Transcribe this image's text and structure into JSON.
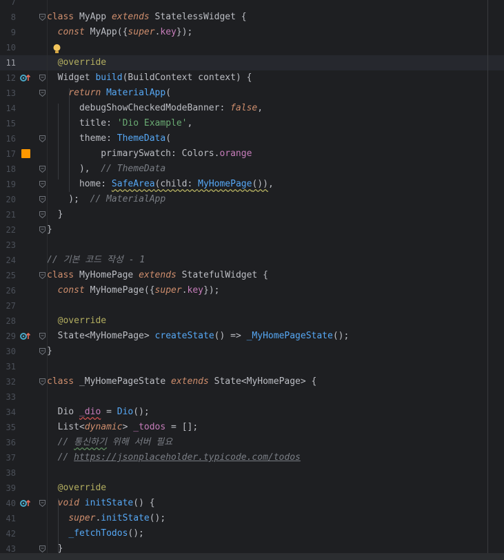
{
  "editor": {
    "language": "Dart",
    "current_line": "11",
    "lines": [
      {
        "n": "7",
        "tokens": []
      },
      {
        "n": "8",
        "tokens": [
          [
            "kw",
            "class"
          ],
          [
            "cls",
            " MyApp "
          ],
          [
            "kwi",
            "extends"
          ],
          [
            "cls",
            " StatelessWidget {"
          ]
        ]
      },
      {
        "n": "9",
        "tokens": [
          [
            "cls",
            "  "
          ],
          [
            "kwi",
            "const"
          ],
          [
            "cls",
            " MyApp({"
          ],
          [
            "kwi",
            "super"
          ],
          [
            "cls",
            "."
          ],
          [
            "prop",
            "key"
          ],
          [
            "cls",
            "});"
          ]
        ]
      },
      {
        "n": "10",
        "tokens": []
      },
      {
        "n": "11",
        "tokens": [
          [
            "cls",
            "  "
          ],
          [
            "anno",
            "@override"
          ]
        ]
      },
      {
        "n": "12",
        "tokens": [
          [
            "cls",
            "  Widget "
          ],
          [
            "fn",
            "build"
          ],
          [
            "cls",
            "(BuildContext context) {"
          ]
        ]
      },
      {
        "n": "13",
        "tokens": [
          [
            "cls",
            "    "
          ],
          [
            "kwi",
            "return"
          ],
          [
            "cls",
            " "
          ],
          [
            "fn",
            "MaterialApp"
          ],
          [
            "cls",
            "("
          ]
        ]
      },
      {
        "n": "14",
        "tokens": [
          [
            "cls",
            "      debugShowCheckedModeBanner: "
          ],
          [
            "kwi",
            "false"
          ],
          [
            "cls",
            ","
          ]
        ]
      },
      {
        "n": "15",
        "tokens": [
          [
            "cls",
            "      title: "
          ],
          [
            "str",
            "'Dio Example'"
          ],
          [
            "cls",
            ","
          ]
        ]
      },
      {
        "n": "16",
        "tokens": [
          [
            "cls",
            "      theme: "
          ],
          [
            "fn",
            "ThemeData"
          ],
          [
            "cls",
            "("
          ]
        ]
      },
      {
        "n": "17",
        "tokens": [
          [
            "cls",
            "          primarySwatch: Colors."
          ],
          [
            "prop",
            "orange"
          ]
        ]
      },
      {
        "n": "18",
        "tokens": [
          [
            "cls",
            "      ),  "
          ],
          [
            "cmt",
            "// ThemeData"
          ]
        ]
      },
      {
        "n": "19",
        "tokens": [
          [
            "cls",
            "      home: "
          ],
          [
            "fn warn-u",
            "SafeArea"
          ],
          [
            "cls warn-u",
            "(child: "
          ],
          [
            "fn warn-u",
            "MyHomePage"
          ],
          [
            "cls warn-u",
            "())"
          ],
          [
            "cls",
            ","
          ]
        ]
      },
      {
        "n": "20",
        "tokens": [
          [
            "cls",
            "    );  "
          ],
          [
            "cmt",
            "// MaterialApp"
          ]
        ]
      },
      {
        "n": "21",
        "tokens": [
          [
            "cls",
            "  }"
          ]
        ]
      },
      {
        "n": "22",
        "tokens": [
          [
            "cls",
            "}"
          ]
        ]
      },
      {
        "n": "23",
        "tokens": []
      },
      {
        "n": "24",
        "tokens": [
          [
            "cmt",
            "// 기본 코드 작성 - 1"
          ]
        ]
      },
      {
        "n": "25",
        "tokens": [
          [
            "kw",
            "class"
          ],
          [
            "cls",
            " MyHomePage "
          ],
          [
            "kwi",
            "extends"
          ],
          [
            "cls",
            " StatefulWidget {"
          ]
        ]
      },
      {
        "n": "26",
        "tokens": [
          [
            "cls",
            "  "
          ],
          [
            "kwi",
            "const"
          ],
          [
            "cls",
            " MyHomePage({"
          ],
          [
            "kwi",
            "super"
          ],
          [
            "cls",
            "."
          ],
          [
            "prop",
            "key"
          ],
          [
            "cls",
            "});"
          ]
        ]
      },
      {
        "n": "27",
        "tokens": []
      },
      {
        "n": "28",
        "tokens": [
          [
            "cls",
            "  "
          ],
          [
            "anno",
            "@override"
          ]
        ]
      },
      {
        "n": "29",
        "tokens": [
          [
            "cls",
            "  State<MyHomePage> "
          ],
          [
            "fn",
            "createState"
          ],
          [
            "cls",
            "() => "
          ],
          [
            "fn",
            "_MyHomePageState"
          ],
          [
            "cls",
            "();"
          ]
        ]
      },
      {
        "n": "30",
        "tokens": [
          [
            "cls",
            "}"
          ]
        ]
      },
      {
        "n": "31",
        "tokens": []
      },
      {
        "n": "32",
        "tokens": [
          [
            "kw",
            "class"
          ],
          [
            "cls",
            " _MyHomePageState "
          ],
          [
            "kwi",
            "extends"
          ],
          [
            "cls",
            " State<MyHomePage> {"
          ]
        ]
      },
      {
        "n": "33",
        "tokens": []
      },
      {
        "n": "34",
        "tokens": [
          [
            "cls",
            "  Dio "
          ],
          [
            "prop err-u",
            "_dio"
          ],
          [
            "cls",
            " = "
          ],
          [
            "fn",
            "Dio"
          ],
          [
            "cls",
            "();"
          ]
        ]
      },
      {
        "n": "35",
        "tokens": [
          [
            "cls",
            "  List<"
          ],
          [
            "kwi",
            "dynamic"
          ],
          [
            "cls",
            "> "
          ],
          [
            "prop",
            "_todos"
          ],
          [
            "cls",
            " = [];"
          ]
        ]
      },
      {
        "n": "36",
        "tokens": [
          [
            "cmt",
            "  // "
          ],
          [
            "cmt typo-u",
            "통신하기"
          ],
          [
            "cmt",
            " 위해 서버 필요"
          ]
        ]
      },
      {
        "n": "37",
        "tokens": [
          [
            "cmt",
            "  // "
          ],
          [
            "link",
            "https://jsonplaceholder.typicode.com/todos"
          ]
        ]
      },
      {
        "n": "38",
        "tokens": []
      },
      {
        "n": "39",
        "tokens": [
          [
            "cls",
            "  "
          ],
          [
            "anno",
            "@override"
          ]
        ]
      },
      {
        "n": "40",
        "tokens": [
          [
            "cls",
            "  "
          ],
          [
            "kwi",
            "void"
          ],
          [
            "cls",
            " "
          ],
          [
            "fn",
            "initState"
          ],
          [
            "cls",
            "() {"
          ]
        ]
      },
      {
        "n": "41",
        "tokens": [
          [
            "cls",
            "    "
          ],
          [
            "kwi",
            "super"
          ],
          [
            "cls",
            "."
          ],
          [
            "fn",
            "initState"
          ],
          [
            "cls",
            "();"
          ]
        ]
      },
      {
        "n": "42",
        "tokens": [
          [
            "cls",
            "    "
          ],
          [
            "fn",
            "_fetchTodos"
          ],
          [
            "cls",
            "();"
          ]
        ]
      },
      {
        "n": "43",
        "tokens": [
          [
            "cls",
            "  }"
          ]
        ]
      }
    ],
    "override_marker_lines": [
      "12",
      "29",
      "40"
    ],
    "fold_lines": [
      "8",
      "12",
      "13",
      "16",
      "18",
      "19",
      "20",
      "21",
      "22",
      "25",
      "29",
      "30",
      "32",
      "40",
      "43"
    ],
    "color_swatch": {
      "line": "17",
      "color": "#ff9800"
    },
    "intention_bulb_line": "10",
    "colors": {
      "background": "#1e1f22",
      "keyword": "#cf8e6d",
      "function": "#56a8f5",
      "string": "#6aab73",
      "annotation": "#b3ae60",
      "comment": "#7a7e85",
      "property": "#c77dbb",
      "swatch": "#ff9800"
    }
  }
}
